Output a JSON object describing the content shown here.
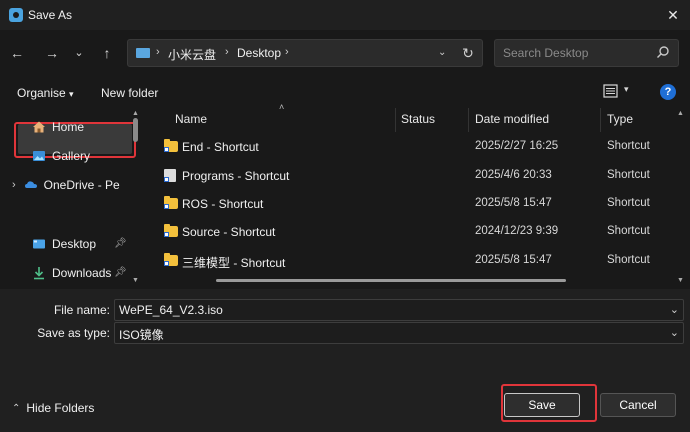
{
  "window": {
    "title": "Save As",
    "close_icon": "close-icon"
  },
  "nav": {
    "back_icon": "arrow-left-icon",
    "forward_icon": "arrow-right-icon",
    "recent_icon": "chevron-down-icon",
    "up_icon": "arrow-up-icon",
    "breadcrumb": [
      "小米云盘",
      "Desktop"
    ],
    "refresh_icon": "refresh-icon",
    "search_placeholder": "Search Desktop"
  },
  "toolbar": {
    "organise_label": "Organise",
    "new_folder_label": "New folder"
  },
  "sidebar": {
    "items": [
      {
        "label": "Home"
      },
      {
        "label": "Gallery"
      },
      {
        "label": "OneDrive - Perso"
      },
      {
        "label": "Desktop",
        "selected": true,
        "pinned": true
      },
      {
        "label": "Downloads",
        "pinned": true
      }
    ]
  },
  "file_list": {
    "columns": [
      "Name",
      "Status",
      "Date modified",
      "Type"
    ],
    "rows": [
      {
        "name": "End - Shortcut",
        "date": "2025/2/27 16:25",
        "type": "Shortcut",
        "icon": "folder-shortcut-icon"
      },
      {
        "name": "Programs - Shortcut",
        "date": "2025/4/6 20:33",
        "type": "Shortcut",
        "icon": "program-shortcut-icon"
      },
      {
        "name": "ROS - Shortcut",
        "date": "2025/5/8 15:47",
        "type": "Shortcut",
        "icon": "folder-shortcut-icon"
      },
      {
        "name": "Source - Shortcut",
        "date": "2024/12/23 9:39",
        "type": "Shortcut",
        "icon": "folder-shortcut-icon"
      },
      {
        "name": "三维模型 - Shortcut",
        "date": "2025/5/8 15:47",
        "type": "Shortcut",
        "icon": "folder-shortcut-icon"
      }
    ]
  },
  "form": {
    "file_name_label": "File name:",
    "file_name_value": "WePE_64_V2.3.iso",
    "save_type_label": "Save as type:",
    "save_type_value": "ISO镜像"
  },
  "footer": {
    "hide_folders_label": "Hide Folders",
    "save_label": "Save",
    "cancel_label": "Cancel"
  },
  "colors": {
    "accent": "#1f6fd6",
    "highlight": "#e0353a",
    "folder": "#f3c03c"
  }
}
